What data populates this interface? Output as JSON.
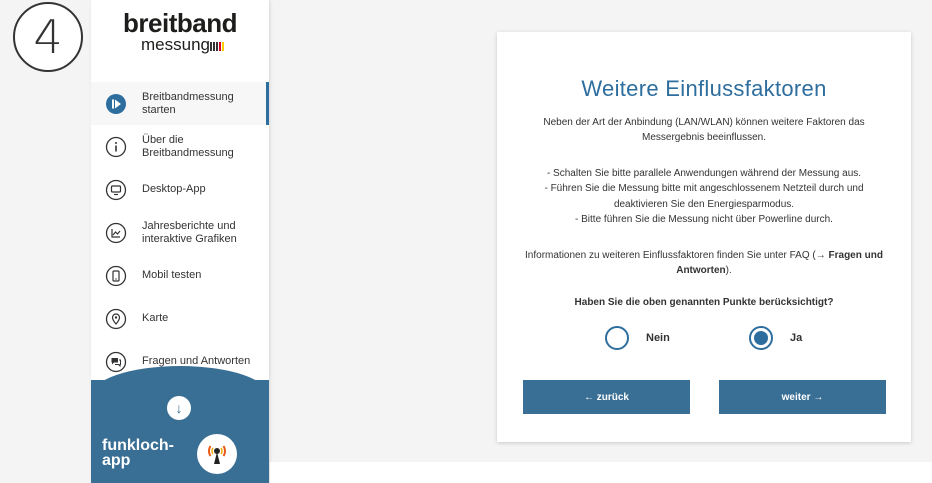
{
  "step_badge": "4",
  "logo": {
    "top": "breitband",
    "bottom": "messung"
  },
  "sidebar": {
    "items": [
      {
        "label": "Breitbandmessung starten",
        "icon": "play-icon",
        "active": true
      },
      {
        "label": "Über die Breitbandmessung",
        "icon": "info-icon",
        "active": false
      },
      {
        "label": "Desktop-App",
        "icon": "monitor-icon",
        "active": false
      },
      {
        "label": "Jahresberichte und interaktive Grafiken",
        "icon": "chart-icon",
        "active": false
      },
      {
        "label": "Mobil testen",
        "icon": "mobile-icon",
        "active": false
      },
      {
        "label": "Karte",
        "icon": "map-pin-icon",
        "active": false
      },
      {
        "label": "Fragen und Antworten",
        "icon": "chat-icon",
        "active": false
      }
    ],
    "funkloch": "funkloch-\napp"
  },
  "card": {
    "title": "Weitere Einflussfaktoren",
    "intro": "Neben der Art der Anbindung (LAN/WLAN) können weitere Faktoren das Messergebnis beeinflussen.",
    "bullets": [
      "- Schalten Sie bitte parallele Anwendungen während der Messung aus.",
      "- Führen Sie die Messung bitte mit angeschlossenem Netzteil durch und deaktivieren Sie den Energiesparmodus.",
      "- Bitte führen Sie die Messung nicht über Powerline durch."
    ],
    "info_prefix": "Informationen zu weiteren Einflussfaktoren finden Sie unter FAQ (",
    "info_link": "→ Fragen und Antworten",
    "info_suffix": ").",
    "question": "Haben Sie die oben genannten Punkte berücksichtigt?",
    "options": [
      {
        "label": "Nein",
        "selected": false
      },
      {
        "label": "Ja",
        "selected": true
      }
    ],
    "back_label": "← zurück",
    "next_label": "weiter →"
  },
  "colors": {
    "accent": "#2e6e9e",
    "button": "#3a6f95"
  }
}
